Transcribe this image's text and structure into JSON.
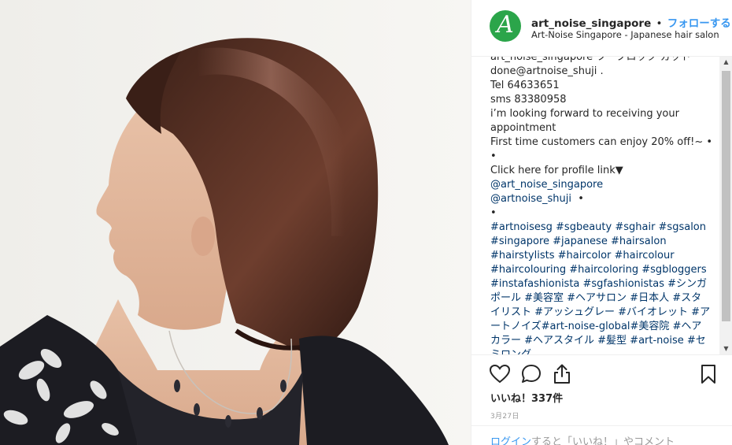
{
  "header": {
    "username": "art_noise_singapore",
    "separator": "•",
    "follow_label": "フォローする",
    "subtitle": "Art-Noise Singapore - Japanese hair salon",
    "avatar_letter": "A"
  },
  "caption": {
    "lines": [
      "art_noise_singapore ツーブロック カット",
      "done@artnoise_shuji .",
      "Tel 64633651",
      "sms 83380958",
      "i’m looking forward to receiving your",
      "appointment",
      "First time customers can enjoy 20% off!~  •",
      "•",
      "Click here for profile link▼"
    ],
    "mention1": "@art_noise_singapore",
    "mention2": "@artnoise_shuji",
    "bullet": "•",
    "hashtags": "#artnoisesg #sgbeauty #sghair #sgsalon #singapore #japanese #hairsalon #hairstylists #haircolor #haircolour #haircolouring #haircoloring #sgbloggers #instafashionista #sgfashionistas #シンガポール #美容室 #ヘアサロン #日本人 #スタイリスト #アッシュグレー #バイオレット #アートノイズ#art-noise-global#美容院 #ヘアカラー #ヘアスタイル #髪型 #art-noise #セミロング"
  },
  "actions": {
    "like_icon": "heart-icon",
    "comment_icon": "comment-icon",
    "share_icon": "share-icon",
    "save_icon": "bookmark-icon"
  },
  "likes_text": "いいね！337件",
  "date_text": "3月27日",
  "login": {
    "link": "ログイン",
    "rest": "すると「いいね！」やコメント"
  },
  "colors": {
    "accent": "#3897f0",
    "avatar_bg": "#2ba54a",
    "hashtag": "#003569"
  }
}
